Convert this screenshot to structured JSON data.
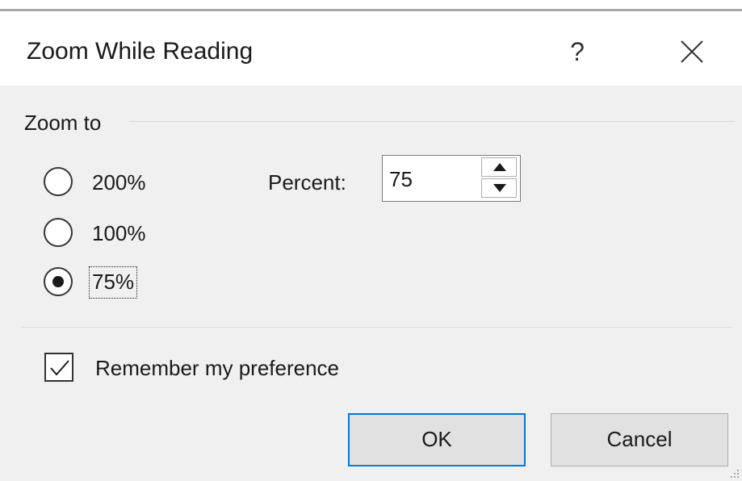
{
  "dialog": {
    "title": "Zoom While Reading",
    "help_label": "?",
    "close_icon": "close-icon"
  },
  "zoom_group": {
    "label": "Zoom to",
    "options": [
      {
        "label": "200%",
        "selected": false
      },
      {
        "label": "100%",
        "selected": false
      },
      {
        "label": "75%",
        "selected": true
      }
    ],
    "percent_label": "Percent:",
    "percent_value": "75"
  },
  "remember": {
    "label": "Remember my preference",
    "checked": true
  },
  "buttons": {
    "ok": "OK",
    "cancel": "Cancel"
  },
  "colors": {
    "accent": "#0078d7",
    "background": "#f0f0f0",
    "titlebar": "#ffffff"
  }
}
